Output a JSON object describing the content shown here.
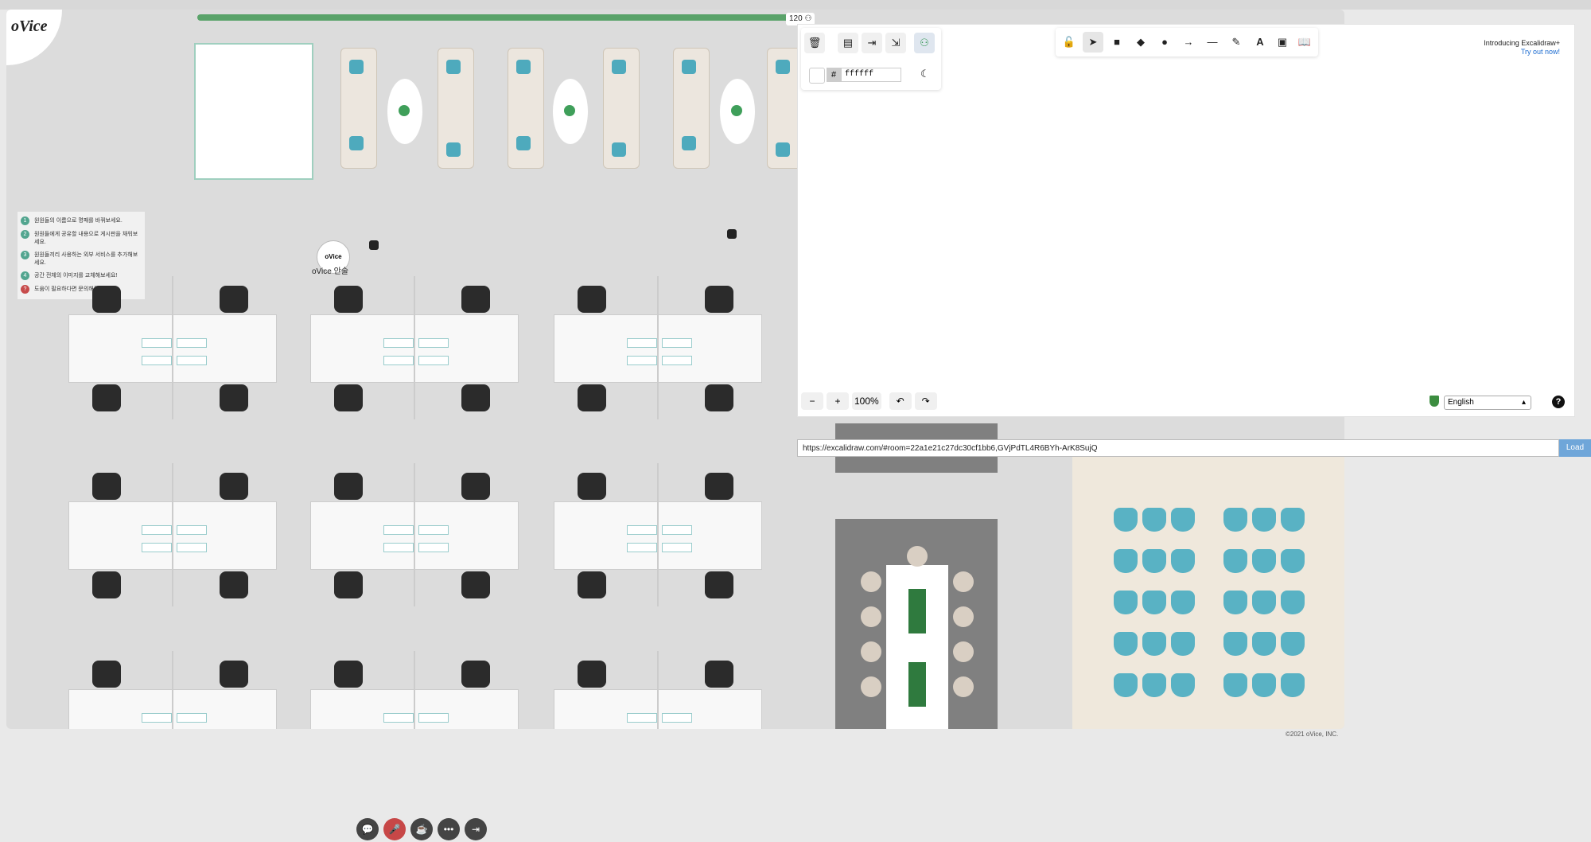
{
  "app": {
    "logo_text": "oVice",
    "copyright": "©2021 oVice, INC.",
    "user_count": "120"
  },
  "map": {
    "ovice_bubble_text": "oVice",
    "ovice_label": "oVice 안술",
    "info_steps": [
      {
        "num": "1",
        "text": "원원들의 이름으로 명패를 바꿔보세요."
      },
      {
        "num": "2",
        "text": "원원들에게 공유할 내용으로 게시판을 채워보세요."
      },
      {
        "num": "3",
        "text": "원원들끼리 사용하는 외부 서비스를 추가해보세요."
      },
      {
        "num": "4",
        "text": "공간 전체의 이미지를 교체해보세요!"
      },
      {
        "num": "?",
        "text": "도움이 필요하다면 문의해주세요!"
      }
    ]
  },
  "excalidraw": {
    "color_hex": "ffffff",
    "hash_symbol": "#",
    "intro_title": "Introducing Excalidraw+",
    "intro_link": "Try out now!",
    "zoom_level": "100%",
    "language": "English",
    "toolbar_left": [
      "trash-icon",
      "open-icon",
      "export-icon",
      "export-image-icon",
      "collab-icon"
    ],
    "tools": [
      "lock-icon",
      "select-icon",
      "rectangle-icon",
      "diamond-icon",
      "ellipse-icon",
      "arrow-icon",
      "line-icon",
      "pencil-icon",
      "text-icon",
      "image-icon",
      "library-icon"
    ]
  },
  "urlbar": {
    "value": "https://excalidraw.com/#room=22a1e21c27dc30cf1bb6,GVjPdTL4R6BYh-ArK8SujQ",
    "load_label": "Load"
  },
  "dock": [
    "chat-icon",
    "mic-muted-icon",
    "coffee-icon",
    "more-icon",
    "exit-icon"
  ]
}
